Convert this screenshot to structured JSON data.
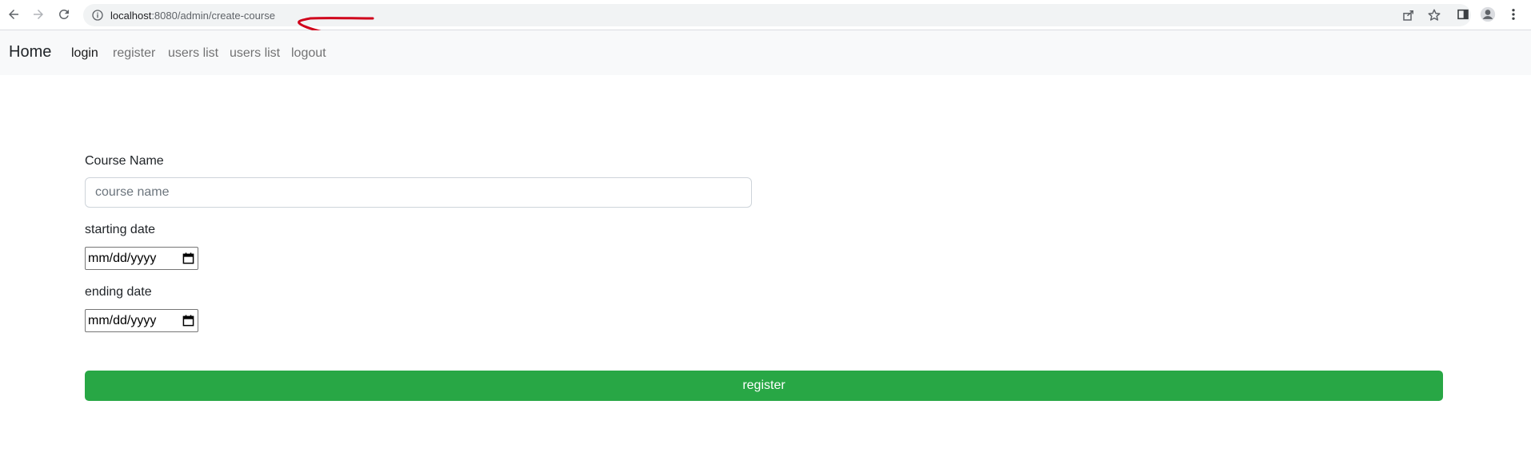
{
  "browser": {
    "url_host": "localhost",
    "url_path": ":8080/admin/create-course",
    "back_icon": "arrow-left-icon",
    "forward_icon": "arrow-right-icon",
    "reload_icon": "reload-icon",
    "annotation_color": "#d0021b"
  },
  "navbar": {
    "brand": "Home",
    "links": [
      "login",
      "register",
      "users list",
      "users list",
      "logout"
    ]
  },
  "form": {
    "course_name_label": "Course Name",
    "course_name_placeholder": "course name",
    "start_label": "starting date",
    "start_value": "mm/dd/yyyy",
    "end_label": "ending date",
    "end_value": "mm/dd/yyyy",
    "submit_label": "register",
    "submit_color": "#28a745"
  }
}
